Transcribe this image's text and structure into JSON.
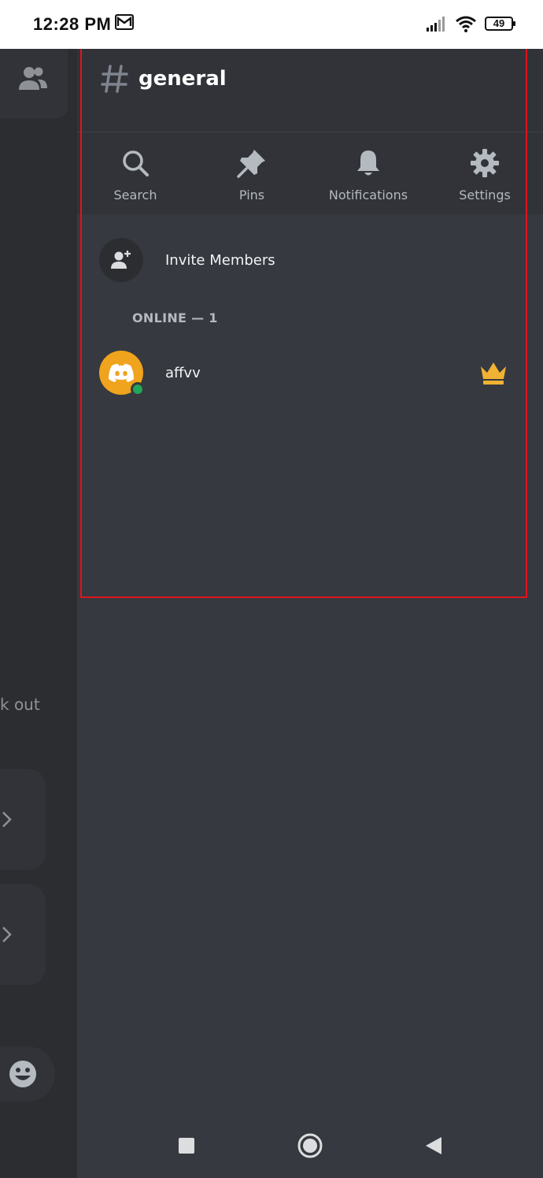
{
  "status_bar": {
    "time": "12:28 PM",
    "battery": "49",
    "icons": [
      "mail-icon",
      "signal-icon",
      "wifi-icon",
      "battery-icon"
    ]
  },
  "background_chat": {
    "snippet": "k out",
    "icons": [
      "members-icon",
      "chevron-right-icon",
      "emoji-icon"
    ]
  },
  "drawer": {
    "channel_hash": "#",
    "channel_name": "general",
    "actions": [
      {
        "label": "Search",
        "icon": "search-icon"
      },
      {
        "label": "Pins",
        "icon": "pin-icon"
      },
      {
        "label": "Notifications",
        "icon": "bell-icon"
      },
      {
        "label": "Settings",
        "icon": "gear-icon"
      }
    ],
    "invite_label": "Invite Members",
    "online_heading": "ONLINE — 1",
    "members": [
      {
        "name": "affvv",
        "avatar_color": "#f0a31c",
        "status": "online",
        "owner": true
      }
    ]
  },
  "colors": {
    "drawer_bg": "#36393f",
    "header_bg": "#313338",
    "online_green": "#23a55a",
    "crown_gold": "#f0b232",
    "highlight_red": "#e0141e"
  }
}
